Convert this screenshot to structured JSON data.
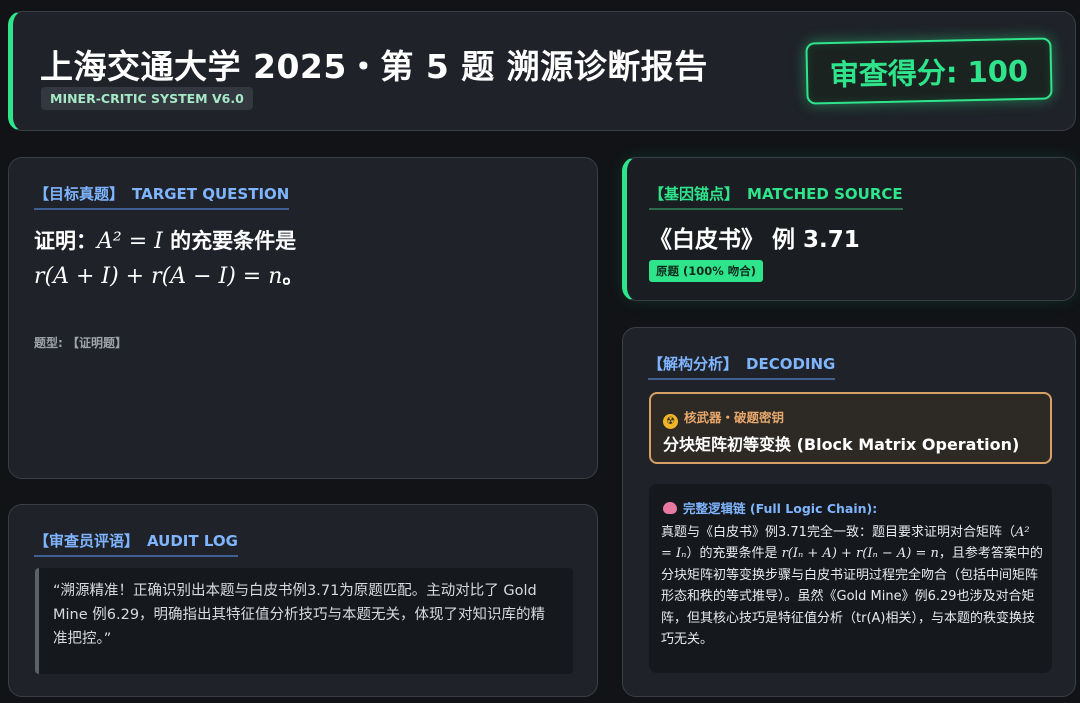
{
  "header": {
    "title": "上海交通大学 2025・第 5 题 溯源诊断报告",
    "system_badge": "MINER-CRITIC SYSTEM V6.0",
    "score": "审查得分: 100"
  },
  "target_question": {
    "tag": "【目标真题】",
    "heading": "TARGET QUESTION",
    "prefix": "证明：",
    "math_1": "A² = I",
    "mid": " 的充要条件是",
    "math_2": "r(A + I) + r(A − I) = n",
    "suffix": "。",
    "type": "题型: 【证明题】"
  },
  "matched_source": {
    "tag": "【基因锚点】",
    "heading": "MATCHED SOURCE",
    "name": "《白皮书》 例 3.71",
    "badge": "原题 (100% 吻合)"
  },
  "decoding": {
    "tag": "【解构分析】",
    "heading": "DECODING",
    "weapon_label": "核武器・破题密钥",
    "weapon_title": "分块矩阵初等变换 (Block Matrix Operation)",
    "chain_label": "完整逻辑链 (Full Logic Chain):",
    "chain_p1": "真题与《白皮书》例3.71完全一致：题目要求证明对合矩阵（",
    "chain_m1": "A² = Iₙ",
    "chain_p2": "）的充要条件是 ",
    "chain_m2": "r(Iₙ + A) + r(Iₙ − A) = n",
    "chain_p3": "，且参考答案中的分块矩阵初等变换步骤与白皮书证明过程完全吻合（包括中间矩阵形态和秩的等式推导）。虽然《Gold Mine》例6.29也涉及对合矩阵，但其核心技巧是特征值分析（tr(A)相关），与本题的秩变换技巧无关。"
  },
  "audit_log": {
    "tag": "【审查员评语】",
    "heading": "AUDIT LOG",
    "quote": "“溯源精准！正确识别出本题与白皮书例3.71为原题匹配。主动对比了 Gold Mine 例6.29，明确指出其特征值分析技巧与本题无关，体现了对知识库的精准把控。”"
  },
  "colors": {
    "accent_green": "#2ee58c",
    "accent_blue": "#7fb4ff",
    "accent_orange": "#d9a066",
    "background": "#111317",
    "card": "#1f2228"
  },
  "icons": {
    "nuke": "radioactive-icon",
    "chain": "brain-icon"
  }
}
